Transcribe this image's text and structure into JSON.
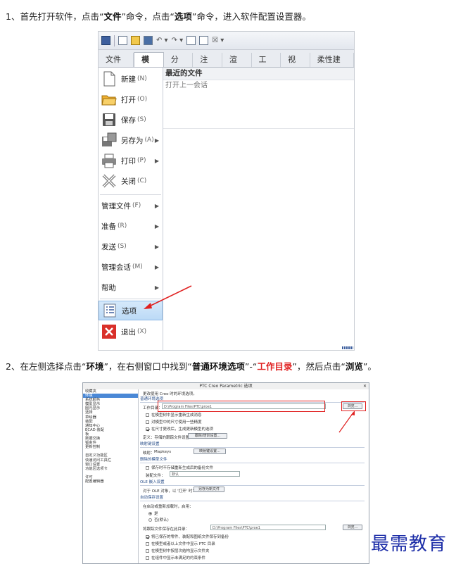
{
  "step1": {
    "prefix": "1、首先打开软件，点击“",
    "b1": "文件",
    "mid1": "”命令，点击“",
    "b2": "选项",
    "suffix": "”命令，进入软件配置设置器。"
  },
  "step2": {
    "prefix": "2、在左侧选择点击“",
    "b1": "环境",
    "mid1": "”，在右侧窗口中找到“",
    "b2": "普通环境选项",
    "mid2": "”-“",
    "red": "工作目录",
    "mid3": "”，然后点击“",
    "b3": "浏览",
    "suffix": "”。"
  },
  "shot1": {
    "qat_extra": "☒ ▾",
    "tabs": [
      "文件 ▾",
      "模型",
      "分析",
      "注释",
      "渲染",
      "工具",
      "视图",
      "柔性建模"
    ],
    "menu": {
      "new": {
        "label": "新建",
        "shortcut": "(N)"
      },
      "open": {
        "label": "打开",
        "shortcut": "(O)"
      },
      "save": {
        "label": "保存",
        "shortcut": "(S)"
      },
      "saveas": {
        "label": "另存为",
        "shortcut": "(A)"
      },
      "print": {
        "label": "打印",
        "shortcut": "(P)"
      },
      "close": {
        "label": "关闭",
        "shortcut": "(C)"
      },
      "manage": {
        "label": "管理文件",
        "shortcut": "(F)"
      },
      "prepare": {
        "label": "准备",
        "shortcut": "(R)"
      },
      "send": {
        "label": "发送",
        "shortcut": "(S)"
      },
      "session": {
        "label": "管理会话",
        "shortcut": "(M)"
      },
      "help": {
        "label": "帮助",
        "shortcut": ""
      },
      "options": {
        "label": "选项",
        "shortcut": ""
      },
      "exit": {
        "label": "退出",
        "shortcut": "(X)"
      }
    },
    "recent_title": "最近的文件",
    "recent_item": "打开上一会话"
  },
  "shot2": {
    "title": "PTC Creo Parametric 选项",
    "close": "✕",
    "tree": [
      "收藏夹",
      "环境",
      "系统颜色",
      "模型显示",
      "图元显示",
      "选择",
      "草绘器",
      "装配",
      "通知中心",
      "ECAD 装配",
      "板",
      "数据交换",
      "钣金件",
      "更新控制",
      "",
      "自定义功能区",
      "快速访问工具栏",
      "窗口设置",
      "功能区选项卡",
      "",
      "许可",
      "配置编辑器"
    ],
    "intro": "更改使用 Creo 时的环境选项。",
    "sec_common": "普通环境选项",
    "workdir_label": "工作目录：",
    "workdir_value": "D:\\Program Files\\PTC\\proe1",
    "browse": "浏览...",
    "cb1": "在模型树中显示重新生成消息",
    "cb2": "对模型中的尺寸使用一些精度",
    "cb3": "在尺寸更改后，生成更新模型的选项",
    "trail_label": "定义：存储的跟踪文件设置：",
    "trail_btn": "跟踪/培训设置...",
    "sec_mapkeys": "映射键设置",
    "mapkeys_label": "映射：",
    "mapkeys_value": "Mapkeys",
    "mapkeys_btn": "映射键设置...",
    "sec_rename": "删除的模型文件",
    "rename_cb": "保存时不存储重新生成后的备份文件",
    "rename_label": "装配文件：",
    "rename_value": "默认",
    "sec_ole": "OLE 嵌入设置",
    "ole_label": "对于 OLE 对象，以 '打开' 时：",
    "ole_btn": "另存为新文件",
    "sec_instance": "自动保存设置",
    "instance_label": "在启动或重新加载时，启用：",
    "rb1": "是",
    "rb2": "否(默认)",
    "trail_dir_label": "将跟踪文件保存在此目录：",
    "trail_dir_value": "D:\\Program Files\\PTC\\proe1",
    "browse2": "浏览...",
    "cb4": "将已保存的零件、装配和图纸文件保存到备份",
    "cb5": "在模型或者以上文件中显示 PTC 目录",
    "cb6": "在模型树中按层次结构显示文件夹",
    "cb7": "在组件中显示未满足的约束条件",
    "watermark": "最需教育"
  }
}
